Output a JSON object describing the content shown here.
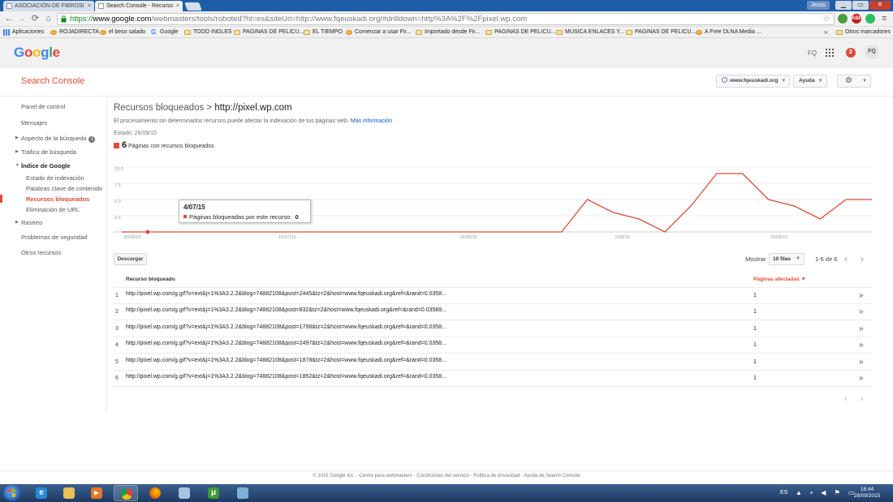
{
  "browser": {
    "tabs": [
      {
        "title": "ASOCIACIÓN DE FIBROSI",
        "active": false
      },
      {
        "title": "Search Console - Recurso",
        "active": true
      }
    ],
    "user_chip": "Jesús",
    "url_scheme": "https://",
    "url_host": "www.google.com",
    "url_rest": "/webmasters/tools/roboted?hl=es&siteUrl=http://www.fqeuskadi.org/#drilldown=http%3A%2F%2Fpixel.wp.com",
    "extensions": [
      {
        "name": "translate",
        "label": "",
        "color": "#4a9d3c"
      },
      {
        "name": "adblock",
        "label": "ABP",
        "color": "#c41e1e"
      },
      {
        "name": "evernote",
        "label": "",
        "color": "#2dbe60"
      }
    ]
  },
  "bookmarks": {
    "apps_label": "Aplicaciones",
    "items": [
      {
        "label": "ROJADIRECTA",
        "icon": "site"
      },
      {
        "label": "el beso salado",
        "icon": "site"
      },
      {
        "label": "Google",
        "icon": "google"
      },
      {
        "label": "TODO INGLES",
        "icon": "folder"
      },
      {
        "label": "PAGINAS DE PELICU...",
        "icon": "folder"
      },
      {
        "label": "EL TIEMPO",
        "icon": "folder"
      },
      {
        "label": "Comenzar a usar Fir...",
        "icon": "firefox"
      },
      {
        "label": "Importado desde Fir...",
        "icon": "folder"
      },
      {
        "label": "PAGINAS DE PELICU...",
        "icon": "folder"
      },
      {
        "label": "MUSICA ENLACES Y...",
        "icon": "folder"
      },
      {
        "label": "PAGINAS DE PELICU...",
        "icon": "folder"
      },
      {
        "label": "A Free DLNA Media ...",
        "icon": "site"
      }
    ],
    "more": "»",
    "other": "Otros marcadores"
  },
  "google_header": {
    "logo_letters": [
      "G",
      "o",
      "o",
      "g",
      "l",
      "e"
    ],
    "account_short": "FQ",
    "notifications": "2",
    "avatar": "FQ"
  },
  "sc_bar": {
    "title": "Search Console",
    "site": "www.fqeuskadi.org",
    "help": "Ayuda"
  },
  "left_nav": [
    {
      "label": "Panel de control",
      "type": "top"
    },
    {
      "label": "Mensajes",
      "type": "top"
    },
    {
      "label": "Aspecto de la búsqueda",
      "type": "section",
      "expanded": false
    },
    {
      "label": "Tráfico de búsqueda",
      "type": "section",
      "expanded": false
    },
    {
      "label": "Índice de Google",
      "type": "section",
      "expanded": true
    },
    {
      "label": "Estado de indexación",
      "type": "sub"
    },
    {
      "label": "Palabras clave de contenido",
      "type": "sub"
    },
    {
      "label": "Recursos bloqueados",
      "type": "sub-active"
    },
    {
      "label": "Eliminación de URL",
      "type": "sub"
    },
    {
      "label": "Rastreo",
      "type": "section",
      "expanded": false
    },
    {
      "label": "Problemas de seguridad",
      "type": "top"
    },
    {
      "label": "Otros recursos",
      "type": "top"
    }
  ],
  "main": {
    "title_prefix": "Recursos bloqueados > ",
    "title_host": "http://pixel.wp.com",
    "description": "El procesamiento sin determinados recursos puede afectar la indexación de tus páginas web.",
    "more_info": "Más información",
    "status": "Estado: 26/09/15",
    "legend_count": "6",
    "legend_label": "Páginas con recursos bloqueados",
    "download": "Descargar",
    "show_label": "Mostrar",
    "rows_option": "10 filas",
    "pager_text": "1-6 de 6",
    "col_resource": "Recurso bloqueado",
    "col_pages": "Páginas afectadas ▼"
  },
  "chart_data": {
    "type": "line",
    "series": [
      {
        "name": "Páginas bloqueadas por este recurso",
        "color": "#dd4b39",
        "values": [
          0,
          0,
          0,
          0,
          0,
          0,
          0,
          0,
          0,
          0,
          0,
          0,
          0,
          0,
          0,
          0,
          0,
          0,
          5,
          3,
          2,
          0,
          4,
          9,
          9,
          5,
          4,
          2,
          5,
          5
        ]
      }
    ],
    "x_tick_labels": [
      "30/06/15",
      "15/07/15",
      "18/08/15",
      "1/09/15",
      "15/09/15"
    ],
    "y_tick_labels": [
      "2,5",
      "5,0",
      "7,5",
      "10,0"
    ],
    "ylim": [
      0,
      10
    ],
    "grid": true,
    "highlight_index": 1,
    "tooltip_date": "4/07/15",
    "tooltip_label": "Páginas bloqueadas por este recurso:",
    "tooltip_value": "0"
  },
  "table": {
    "rows": [
      {
        "idx": "1",
        "resource": "http://pixel.wp.com/g.gif?v=ext&j=1%3A3.2.2&blog=74882108&post=2445&tz=2&host=www.fqeuskadi.org&ref=&rand=0.0358...",
        "pages": "1"
      },
      {
        "idx": "2",
        "resource": "http://pixel.wp.com/g.gif?v=ext&j=1%3A3.2.2&blog=74882108&post=832&tz=2&host=www.fqeuskadi.org&ref=&rand=0.03589...",
        "pages": "1"
      },
      {
        "idx": "3",
        "resource": "http://pixel.wp.com/g.gif?v=ext&j=1%3A3.2.2&blog=74882108&post=1798&tz=2&host=www.fqeuskadi.org&ref=&rand=0.0358...",
        "pages": "1"
      },
      {
        "idx": "4",
        "resource": "http://pixel.wp.com/g.gif?v=ext&j=1%3A3.2.2&blog=74882108&post=2497&tz=2&host=www.fqeuskadi.org&ref=&rand=0.0358...",
        "pages": "1"
      },
      {
        "idx": "5",
        "resource": "http://pixel.wp.com/g.gif?v=ext&j=1%3A3.2.2&blog=74882108&post=1878&tz=2&host=www.fqeuskadi.org&ref=&rand=0.0358...",
        "pages": "1"
      },
      {
        "idx": "6",
        "resource": "http://pixel.wp.com/g.gif?v=ext&j=1%3A3.2.2&blog=74882108&post=1852&tz=2&host=www.fqeuskadi.org&ref=&rand=0.0358...",
        "pages": "1"
      }
    ],
    "row_action": "»"
  },
  "footer": "© 2015 Google Inc. - Centro para webmasters - Condiciones del servicio - Política de privacidad - Ayuda de Search Console",
  "taskbar": {
    "apps": [
      {
        "name": "internet-explorer",
        "glyph": "e",
        "color": "#2a8ad6",
        "running": false
      },
      {
        "name": "file-explorer",
        "glyph": "",
        "color": "#e8c056",
        "running": false
      },
      {
        "name": "media-player",
        "glyph": "▶",
        "color": "#e57623",
        "running": false
      },
      {
        "name": "chrome",
        "glyph": "",
        "color": "#db4437",
        "running": true
      },
      {
        "name": "firefox",
        "glyph": "",
        "color": "#e66000",
        "running": false
      },
      {
        "name": "windows-folder",
        "glyph": "",
        "color": "#a7c4e2",
        "running": false
      },
      {
        "name": "utorrent",
        "glyph": "μ",
        "color": "#3d9a32",
        "running": false
      },
      {
        "name": "paint",
        "glyph": "",
        "color": "#7db2d8",
        "running": false
      }
    ],
    "lang": "ES",
    "time": "16:44",
    "date": "28/09/2015"
  }
}
